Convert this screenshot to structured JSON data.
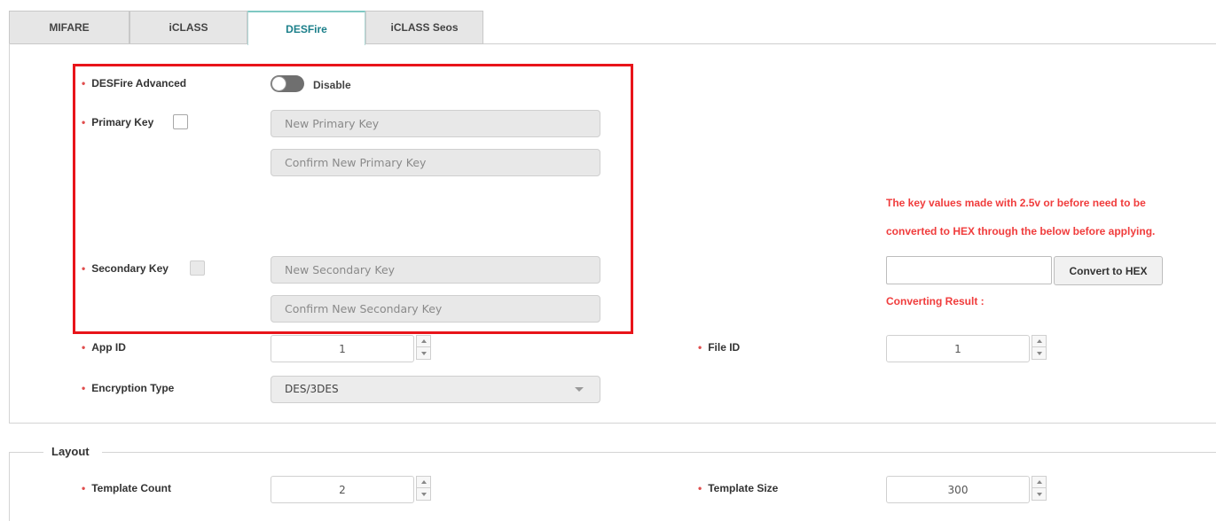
{
  "tabs": [
    {
      "label": "MIFARE"
    },
    {
      "label": "iCLASS"
    },
    {
      "label": "DESFire"
    },
    {
      "label": "iCLASS Seos"
    }
  ],
  "active_tab": "DESFire",
  "desfire": {
    "advanced": {
      "label": "DESFire Advanced",
      "toggle_state": "Disable"
    },
    "primary_key": {
      "label": "Primary Key",
      "new_placeholder": "New Primary Key",
      "confirm_placeholder": "Confirm New Primary Key"
    },
    "secondary_key": {
      "label": "Secondary Key",
      "new_placeholder": "New Secondary Key",
      "confirm_placeholder": "Confirm New Secondary Key"
    },
    "app_id": {
      "label": "App ID",
      "value": "1"
    },
    "file_id": {
      "label": "File ID",
      "value": "1"
    },
    "encryption_type": {
      "label": "Encryption Type",
      "value": "DES/3DES"
    }
  },
  "hex_converter": {
    "warning_line1": "The key values made with 2.5v or before need to be",
    "warning_line2": "converted to HEX through the below before applying.",
    "input_value": "",
    "button_label": "Convert to HEX",
    "result_label": "Converting Result :"
  },
  "layout": {
    "title": "Layout",
    "template_count": {
      "label": "Template Count",
      "value": "2"
    },
    "template_size": {
      "label": "Template Size",
      "value": "300"
    }
  },
  "colors": {
    "accent_teal": "#1b7f8a",
    "required_dot": "#e04d4d",
    "warning_red": "#f03c3c",
    "highlight_red": "#e8141a"
  }
}
